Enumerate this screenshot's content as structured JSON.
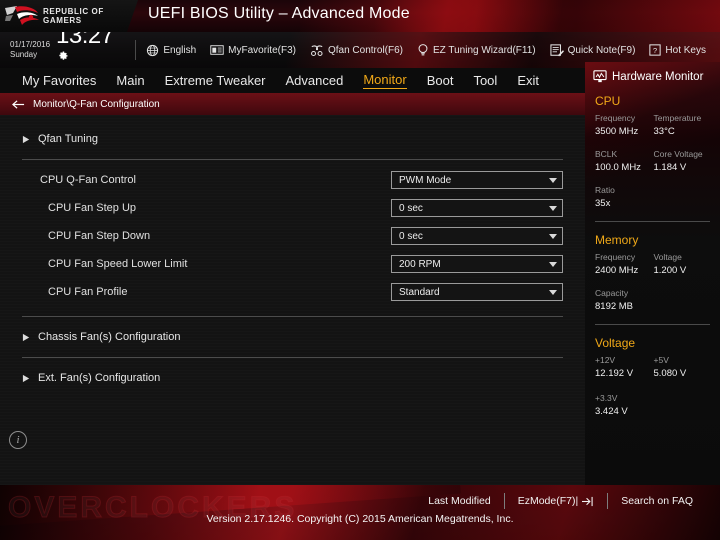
{
  "titlebar": {
    "logo_line1": "REPUBLIC OF",
    "logo_line2": "GAMERS",
    "logo_icon": "rog-eye-logo",
    "app_title": "UEFI BIOS Utility – Advanced Mode"
  },
  "infobar": {
    "date": "01/17/2016",
    "weekday": "Sunday",
    "time": "13:27",
    "gear_icon": "gear-icon",
    "shortcuts": [
      {
        "label": "English",
        "icon": "globe-icon"
      },
      {
        "label": "MyFavorite(F3)",
        "icon": "favorite-card-icon"
      },
      {
        "label": "Qfan Control(F6)",
        "icon": "fan-icon"
      },
      {
        "label": "EZ Tuning Wizard(F11)",
        "icon": "lightbulb-icon"
      },
      {
        "label": "Quick Note(F9)",
        "icon": "note-pencil-icon"
      },
      {
        "label": "Hot Keys",
        "icon": "question-key-icon"
      }
    ]
  },
  "tabs": [
    {
      "label": "My Favorites",
      "active": false
    },
    {
      "label": "Main",
      "active": false
    },
    {
      "label": "Extreme Tweaker",
      "active": false
    },
    {
      "label": "Advanced",
      "active": false
    },
    {
      "label": "Monitor",
      "active": true
    },
    {
      "label": "Boot",
      "active": false
    },
    {
      "label": "Tool",
      "active": false
    },
    {
      "label": "Exit",
      "active": false
    }
  ],
  "breadcrumb": {
    "back_icon": "back-arrow-icon",
    "path": "Monitor\\Q-Fan Configuration"
  },
  "content": {
    "qfan_tuning_link": "Qfan Tuning",
    "settings": [
      {
        "label": "CPU Q-Fan Control",
        "value": "PWM Mode",
        "indent": false
      },
      {
        "label": "CPU Fan Step Up",
        "value": "0 sec",
        "indent": true
      },
      {
        "label": "CPU Fan Step Down",
        "value": "0 sec",
        "indent": true
      },
      {
        "label": "CPU Fan Speed Lower Limit",
        "value": "200 RPM",
        "indent": true
      },
      {
        "label": "CPU Fan Profile",
        "value": "Standard",
        "indent": true
      }
    ],
    "chassis_fan_link": "Chassis Fan(s) Configuration",
    "ext_fan_link": "Ext. Fan(s) Configuration",
    "info_icon": "info-icon",
    "info_icon_glyph": "i"
  },
  "hardware_monitor": {
    "title": "Hardware Monitor",
    "title_icon": "monitor-icon",
    "sections": [
      {
        "name": "CPU",
        "rows": [
          [
            {
              "key": "Frequency",
              "value": "3500 MHz"
            },
            {
              "key": "Temperature",
              "value": "33°C"
            }
          ],
          [
            {
              "key": "BCLK",
              "value": "100.0 MHz"
            },
            {
              "key": "Core Voltage",
              "value": "1.184 V"
            }
          ],
          [
            {
              "key": "Ratio",
              "value": "35x"
            }
          ]
        ]
      },
      {
        "name": "Memory",
        "rows": [
          [
            {
              "key": "Frequency",
              "value": "2400 MHz"
            },
            {
              "key": "Voltage",
              "value": "1.200 V"
            }
          ],
          [
            {
              "key": "Capacity",
              "value": "8192 MB"
            }
          ]
        ]
      },
      {
        "name": "Voltage",
        "rows": [
          [
            {
              "key": "+12V",
              "value": "12.192 V"
            },
            {
              "key": "+5V",
              "value": "5.080 V"
            }
          ],
          [
            {
              "key": "+3.3V",
              "value": "3.424 V"
            }
          ]
        ]
      }
    ]
  },
  "bottom": {
    "watermark": "OVERCLOCKERS",
    "last_modified": "Last Modified",
    "ez_mode": "EzMode(F7)|",
    "ez_mode_icon": "arrow-into-box-icon",
    "search_faq": "Search on FAQ",
    "version": "Version 2.17.1246. Copyright (C) 2015 American Megatrends, Inc."
  },
  "colors": {
    "accent_gold": "#f0a818",
    "rog_red": "#a80e14",
    "panel_bg": "#131313"
  }
}
